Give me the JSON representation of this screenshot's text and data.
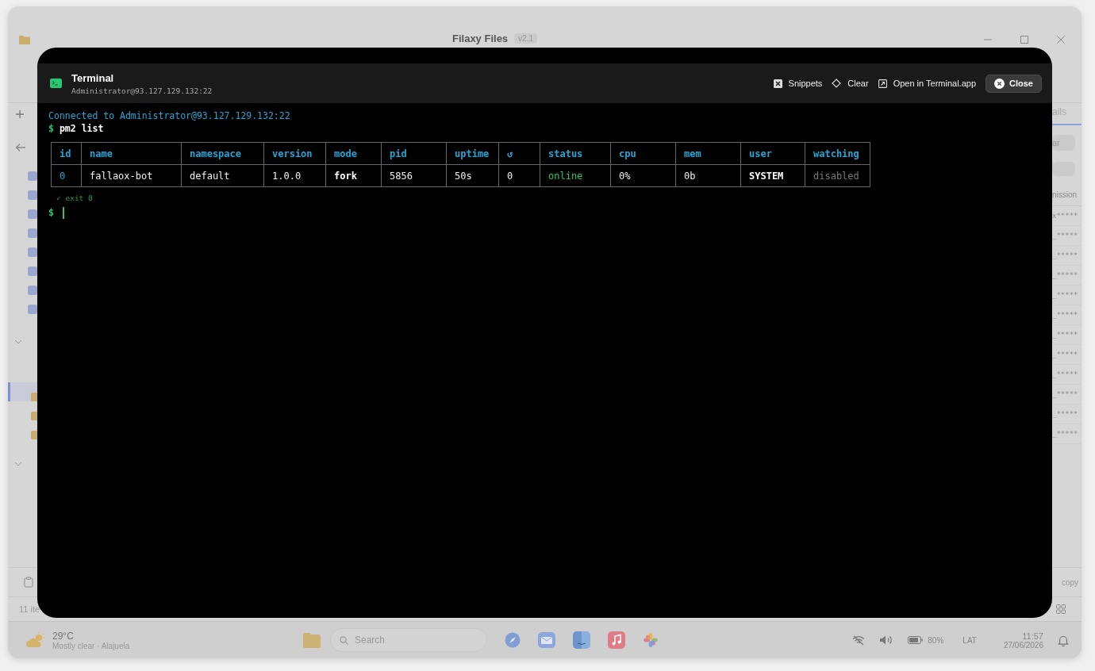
{
  "app_window": {
    "title": "Filaxy Files",
    "version": "v2.1",
    "right_panel": {
      "tab": "ails",
      "button": "ar",
      "column_header": "nission",
      "rows": [
        "x*****",
        "_*****",
        "_*****",
        "_*****",
        "_*****",
        "_*****",
        "_*****",
        "_*****",
        "_*****",
        "_*****",
        "_*****",
        "_*****"
      ],
      "action": "copy"
    },
    "status_bar": {
      "count": "11 ite"
    }
  },
  "terminal": {
    "title": "Terminal",
    "subtitle": "Administrator@93.127.129.132:22",
    "actions": [
      {
        "label": "Snippets",
        "kind": "snippets"
      },
      {
        "label": "Clear",
        "kind": "clear"
      },
      {
        "label": "Open in Terminal.app",
        "kind": "open"
      }
    ],
    "close_label": "Close",
    "connected": "Connected to Administrator@93.127.129.132:22",
    "prompt": "$",
    "command": "pm2 list",
    "table": {
      "columns": [
        "id",
        "name",
        "namespace",
        "version",
        "mode",
        "pid",
        "uptime",
        "↺",
        "status",
        "cpu",
        "mem",
        "user",
        "watching"
      ],
      "rows": [
        {
          "cells": [
            {
              "text": "0",
              "kind": "accent"
            },
            {
              "text": "fallaox-bot",
              "kind": "plain"
            },
            {
              "text": "default",
              "kind": "plain"
            },
            {
              "text": "1.0.0",
              "kind": "plain"
            },
            {
              "text": "fork",
              "kind": "strong"
            },
            {
              "text": "5856",
              "kind": "plain"
            },
            {
              "text": "50s",
              "kind": "plain"
            },
            {
              "text": "0",
              "kind": "plain"
            },
            {
              "text": "online",
              "kind": "success"
            },
            {
              "text": "0%",
              "kind": "plain"
            },
            {
              "text": "0b",
              "kind": "plain"
            },
            {
              "text": "SYSTEM",
              "kind": "strong"
            },
            {
              "text": "disabled",
              "kind": "muted"
            }
          ]
        }
      ]
    },
    "exit_status": "✓ exit 0",
    "input_prompt": "$"
  },
  "taskbar": {
    "temperature": "29°C",
    "weather": "Mostly clear · Alajuela",
    "search_placeholder": "Search",
    "battery": "80%",
    "language": "LAT",
    "time": "11:57",
    "date": "27/06/2026"
  }
}
